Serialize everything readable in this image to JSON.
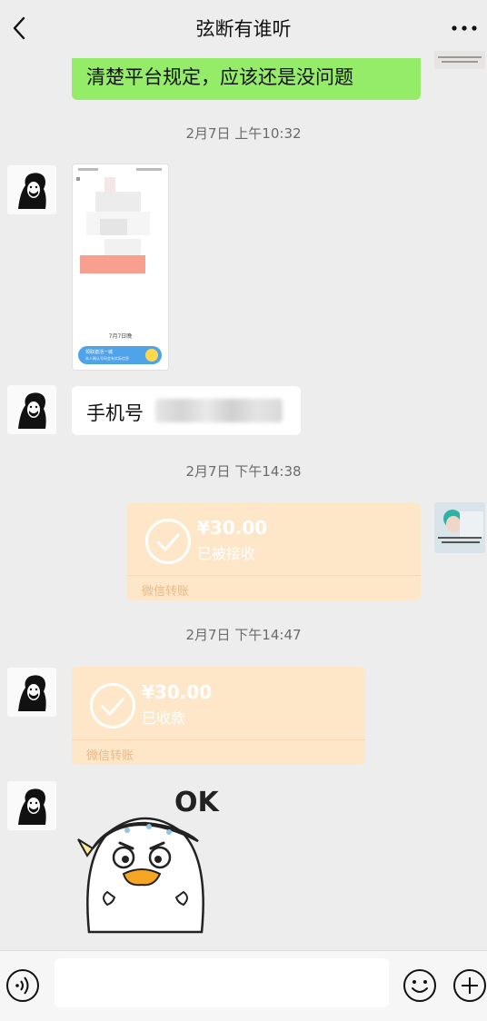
{
  "header": {
    "title": "弦断有谁听",
    "back_icon": "chevron-left-icon",
    "more_icon": "more-dots-icon"
  },
  "messages": {
    "m1_text": "清楚平台规定，应该还是没问题",
    "time1": "2月7日 上午10:32",
    "image_card": {
      "caption": "7月7日晚",
      "banner_line1": "领取激活一城",
      "banner_line2": "本人确认号码会有实际信息"
    },
    "phone_label": "手机号",
    "time2": "2月7日 下午14:38",
    "transfer_sent": {
      "amount": "¥30.00",
      "status": "已被接收",
      "label": "微信转账"
    },
    "time3": "2月7日 下午14:47",
    "transfer_received": {
      "amount": "¥30.00",
      "status": "已收款",
      "label": "微信转账"
    },
    "sticker_text": "OK"
  },
  "inputbar": {
    "voice_icon": "voice-icon",
    "emoji_icon": "emoji-icon",
    "plus_icon": "plus-icon"
  },
  "colors": {
    "background": "#ededed",
    "green_bubble": "#95ec69",
    "transfer_card": "#fde7c8"
  }
}
